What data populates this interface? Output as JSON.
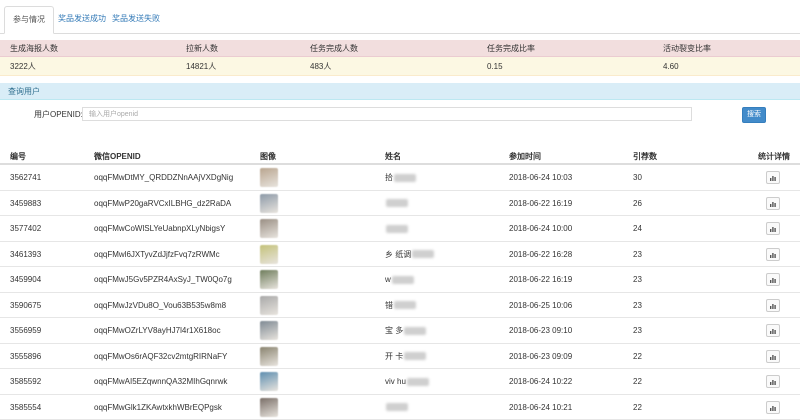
{
  "tabs": [
    {
      "label": "参与情况",
      "active": true
    },
    {
      "label": "奖品发送成功",
      "active": false
    },
    {
      "label": "奖品发送失败",
      "active": false
    }
  ],
  "stats": {
    "headers": [
      "生成海报人数",
      "拉新人数",
      "任务完成人数",
      "任务完成比率",
      "活动裂变比率"
    ],
    "values": [
      "3222人",
      "14821人",
      "483人",
      "0.15",
      "4.60"
    ]
  },
  "query": {
    "title": "查询用户",
    "label": "用户OPENID:",
    "placeholder": "输入用户openid",
    "button": "搜索"
  },
  "table": {
    "headers": {
      "id": "编号",
      "openid": "微信OPENID",
      "avatar": "图像",
      "name": "姓名",
      "time": "参加时间",
      "count": "引荐数",
      "detail": "统计详情"
    },
    "rows": [
      {
        "id": "3562741",
        "openid": "oqqFMwDtMY_QRDDZNnAAjVXDgNig",
        "name": "拾",
        "time": "2018-06-24 10:03",
        "count": "30",
        "avatar_color": "#b9a58f"
      },
      {
        "id": "3459883",
        "openid": "oqqFMwP20gaRVCxILBHG_dz2RaDA",
        "name": "",
        "time": "2018-06-22 16:19",
        "count": "26",
        "avatar_color": "#8d9aa8"
      },
      {
        "id": "3577402",
        "openid": "oqqFMwCoWlSLYeUabnpXLyNbigsY",
        "name": "",
        "time": "2018-06-24 10:00",
        "count": "24",
        "avatar_color": "#9a8f84"
      },
      {
        "id": "3461393",
        "openid": "oqqFMwl6JXTyvZdJjfzFvq7zRWMc",
        "name": "乡 纸调",
        "time": "2018-06-22 16:28",
        "count": "23",
        "avatar_color": "#c4c27a"
      },
      {
        "id": "3459904",
        "openid": "oqqFMwJ5Gv5PZR4AxSyJ_TW0Qo7g",
        "name": "w",
        "time": "2018-06-22 16:19",
        "count": "23",
        "avatar_color": "#6f7d5c"
      },
      {
        "id": "3590675",
        "openid": "oqqFMwJzVDu8O_Vou63B535w8m8",
        "name": "错",
        "time": "2018-06-25 10:06",
        "count": "23",
        "avatar_color": "#a9a9a9"
      },
      {
        "id": "3556959",
        "openid": "oqqFMwOZrLYV8ayHJ7l4r1X618oc",
        "name": "宝 多",
        "time": "2018-06-23 09:10",
        "count": "23",
        "avatar_color": "#7f8a94"
      },
      {
        "id": "3555896",
        "openid": "oqqFMwOs6rAQF32cv2mtgRIRNaFY",
        "name": "开 卡",
        "time": "2018-06-23 09:09",
        "count": "22",
        "avatar_color": "#8a8470"
      },
      {
        "id": "3585592",
        "openid": "oqqFMwAI5EZqwnnQA32MIhGqnrwk",
        "name": "viv hu",
        "time": "2018-06-24 10:22",
        "count": "22",
        "avatar_color": "#5f8fb0"
      },
      {
        "id": "3585554",
        "openid": "oqqFMwGlk1ZKAwtxkhWBrEQPgsk",
        "name": "",
        "time": "2018-06-24 10:21",
        "count": "22",
        "avatar_color": "#7a6f68"
      }
    ]
  }
}
